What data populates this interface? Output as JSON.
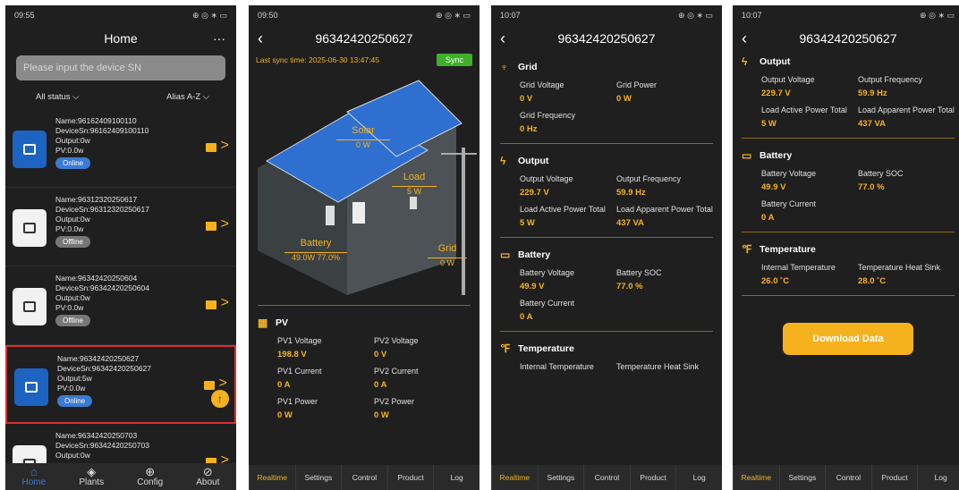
{
  "p1": {
    "status_time": "09:55",
    "status_right": "⊕ ◎ ∗ ▭",
    "title": "Home",
    "more": "···",
    "search_placeholder": "Please input the device SN",
    "filter_status": "All status",
    "filter_sort": "Alias A-Z",
    "devices": [
      {
        "name": "Name:96162409100110",
        "sn": "DeviceSn:96162409100110",
        "output": "Output:0w",
        "pv": "PV:0.0w",
        "status": "Online"
      },
      {
        "name": "Name:96312320250617",
        "sn": "DeviceSn:96312320250617",
        "output": "Output:0w",
        "pv": "PV:0.0w",
        "status": "Offline"
      },
      {
        "name": "Name:96342420250604",
        "sn": "DeviceSn:96342420250604",
        "output": "Output:0w",
        "pv": "PV:0.0w",
        "status": "Offline"
      },
      {
        "name": "Name:96342420250627",
        "sn": "DeviceSn:96342420250627",
        "output": "Output:5w",
        "pv": "PV:0.0w",
        "status": "Online"
      },
      {
        "name": "Name:96342420250703",
        "sn": "DeviceSn:96342420250703",
        "output": "Output:0w",
        "pv": "",
        "status": ""
      }
    ],
    "nav": [
      "Home",
      "Plants",
      "Config",
      "About"
    ]
  },
  "p2": {
    "status_time": "09:50",
    "status_right": "⊕ ◎ ∗ ▭",
    "title": "96342420250627",
    "sync_text": "Last sync time:  2025-06-30 13:47:45",
    "sync_btn": "Sync",
    "solar_label": "Solar",
    "solar_value": "0 W",
    "load_label": "Load",
    "load_value": "5 W",
    "battery_label": "Battery",
    "battery_value": "49.0W 77.0%",
    "grid_label": "Grid",
    "grid_value": "0 W",
    "pv_title": "PV",
    "pv": [
      {
        "k": "PV1 Voltage",
        "v": "198.8 V"
      },
      {
        "k": "PV2 Voltage",
        "v": "0 V"
      },
      {
        "k": "PV1 Current",
        "v": "0 A"
      },
      {
        "k": "PV2 Current",
        "v": "0 A"
      },
      {
        "k": "PV1 Power",
        "v": "0 W"
      },
      {
        "k": "PV2 Power",
        "v": "0 W"
      }
    ]
  },
  "p3": {
    "status_time": "10:07",
    "status_right": "⊕ ◎ ∗ ▭",
    "title": "96342420250627",
    "grid_title": "Grid",
    "grid": [
      {
        "k": "Grid Voltage",
        "v": "0 V"
      },
      {
        "k": "Grid Power",
        "v": "0 W"
      },
      {
        "k": "Grid Frequency",
        "v": "0 Hz"
      }
    ],
    "output_title": "Output",
    "output": [
      {
        "k": "Output Voltage",
        "v": "229.7 V"
      },
      {
        "k": "Output Frequency",
        "v": "59.9 Hz"
      },
      {
        "k": "Load Active Power Total",
        "v": "5 W"
      },
      {
        "k": "Load Apparent Power Total",
        "v": "437 VA"
      }
    ],
    "battery_title": "Battery",
    "battery": [
      {
        "k": "Battery Voltage",
        "v": "49.9 V"
      },
      {
        "k": "Battery SOC",
        "v": "77.0 %"
      },
      {
        "k": "Battery Current",
        "v": "0 A"
      }
    ],
    "temp_title": "Temperature",
    "temp": [
      {
        "k": "Internal Temperature",
        "v": ""
      },
      {
        "k": "Temperature Heat Sink",
        "v": ""
      }
    ]
  },
  "p4": {
    "status_time": "10:07",
    "status_right": "⊕ ◎ ∗ ▭",
    "title": "96342420250627",
    "output_title": "Output",
    "output": [
      {
        "k": "Output Voltage",
        "v": "229.7 V"
      },
      {
        "k": "Output Frequency",
        "v": "59.9 Hz"
      },
      {
        "k": "Load Active Power Total",
        "v": "5 W"
      },
      {
        "k": "Load Apparent Power Total",
        "v": "437 VA"
      }
    ],
    "battery_title": "Battery",
    "battery": [
      {
        "k": "Battery Voltage",
        "v": "49.9 V"
      },
      {
        "k": "Battery SOC",
        "v": "77.0 %"
      },
      {
        "k": "Battery Current",
        "v": "0 A"
      }
    ],
    "temp_title": "Temperature",
    "temp": [
      {
        "k": "Internal Temperature",
        "v": "26.0 ˚C"
      },
      {
        "k": "Temperature Heat Sink",
        "v": "28.0 ˚C"
      }
    ],
    "download": "Download Data"
  },
  "tabs": [
    "Realtime",
    "Settings",
    "Control",
    "Product",
    "Log"
  ],
  "colors": {
    "accent": "#f5b21d",
    "online": "#3a7bd5",
    "offline": "#777777",
    "sync": "#3fae2a",
    "selected_border": "#d93030"
  }
}
